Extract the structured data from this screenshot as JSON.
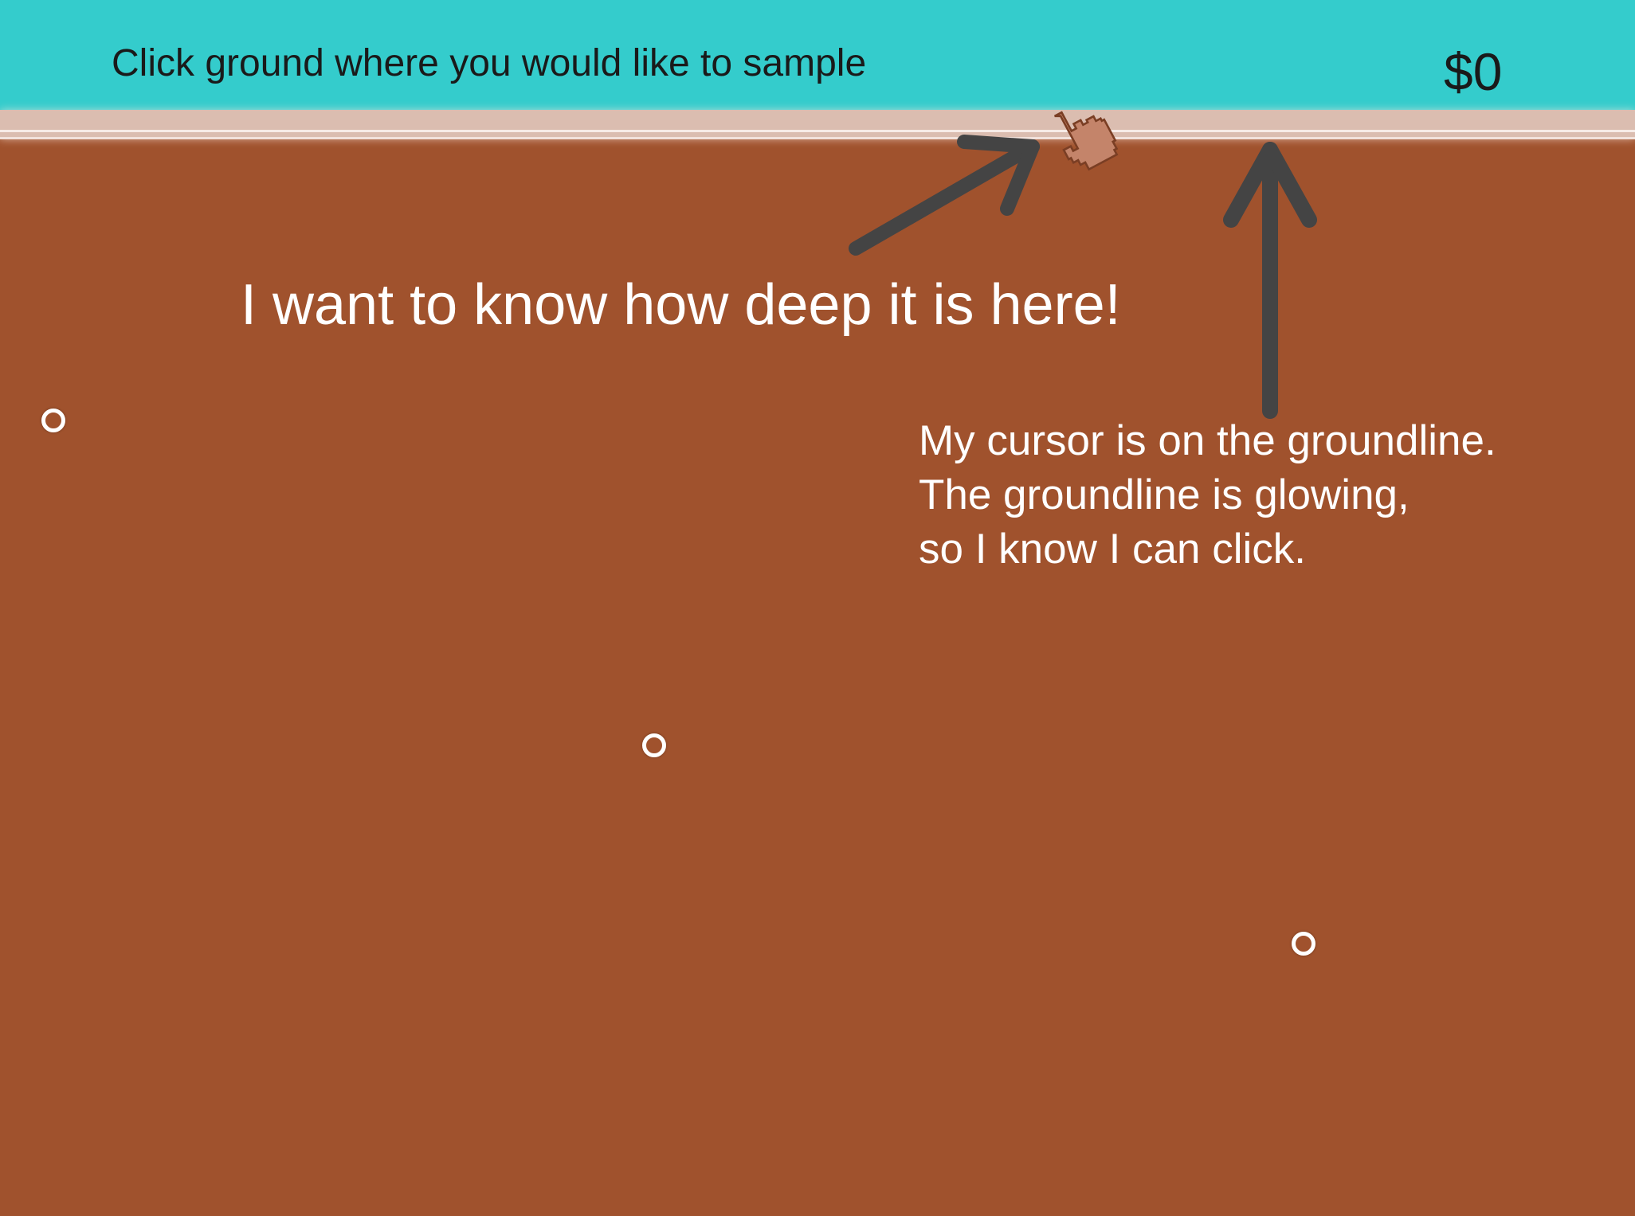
{
  "header": {
    "instruction": "Click ground where you would like to sample",
    "money": "$0"
  },
  "annotations": {
    "speech": "I want to know how deep it is here!",
    "note_lines": [
      "My cursor is on the groundline.",
      "The groundline is glowing,",
      "so I know I can click."
    ]
  },
  "icons": {
    "cursor": "hand-pointer-icon",
    "arrow_diagonal": "arrow-up-right-icon",
    "arrow_vertical": "arrow-up-icon",
    "marker": "circle-icon"
  },
  "colors": {
    "header_bg": "#34cccc",
    "ground": "#a0522d",
    "groundline": "#dbbdb0",
    "annotation_arrow": "#444444",
    "cursor": "#c4846a"
  }
}
